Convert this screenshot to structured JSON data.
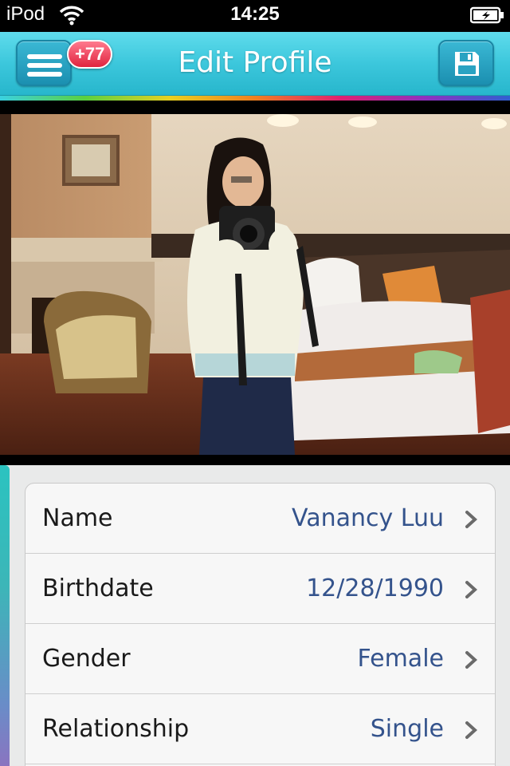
{
  "status_bar": {
    "device": "iPod",
    "time": "14:25"
  },
  "nav": {
    "title": "Edit Profile",
    "badge": "+77"
  },
  "profile_fields": [
    {
      "label": "Name",
      "value": "Vanancy Luu"
    },
    {
      "label": "Birthdate",
      "value": "12/28/1990"
    },
    {
      "label": "Gender",
      "value": "Female"
    },
    {
      "label": "Relationship",
      "value": "Single"
    }
  ],
  "icons": {
    "menu": "hamburger-menu-icon",
    "save": "floppy-disk-icon",
    "chevron": "chevron-right-icon",
    "wifi": "wifi-icon",
    "battery": "battery-icon"
  },
  "colors": {
    "nav_bar": "#3cc7dc",
    "badge": "#e0243f",
    "value_text": "#34538c"
  }
}
